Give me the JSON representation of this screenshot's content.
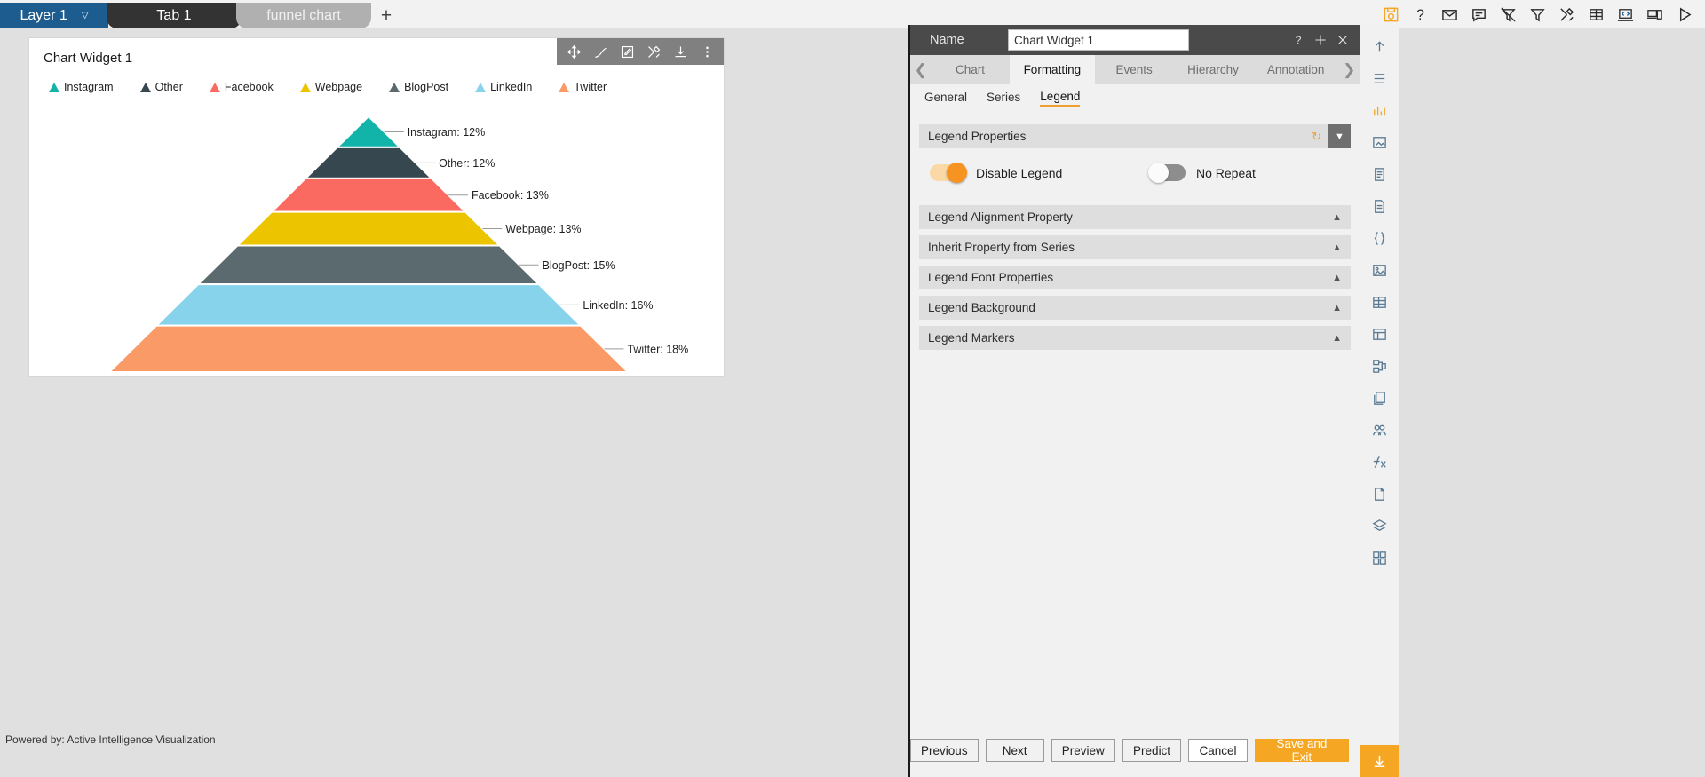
{
  "topbar": {
    "layer_tab": {
      "label": "Layer 1",
      "caret": "chevron-down-icon"
    },
    "tabs": [
      {
        "label": "Tab 1",
        "active": true
      },
      {
        "label": "funnel chart",
        "active": false
      }
    ],
    "add_tab_label": "+",
    "icons": [
      "save-icon",
      "help-icon",
      "mail-icon",
      "comment-icon",
      "filter-off-icon",
      "filter-icon",
      "tools-icon",
      "table-icon",
      "code-icon",
      "devices-icon",
      "play-icon"
    ]
  },
  "widget": {
    "title": "Chart Widget 1",
    "toolbar_icons": [
      "move-icon",
      "pen-icon",
      "edit-icon",
      "tools-icon",
      "download-icon",
      "more-icon"
    ]
  },
  "chart_data": {
    "type": "funnel",
    "title": "Chart Widget 1",
    "legend_position": "top",
    "categories": [
      "Instagram",
      "Other",
      "Facebook",
      "Webpage",
      "BlogPost",
      "LinkedIn",
      "Twitter"
    ],
    "values": [
      12,
      12,
      13,
      13,
      15,
      16,
      18
    ],
    "value_unit": "%",
    "colors": [
      "#12b3a8",
      "#37474f",
      "#fa6a61",
      "#edc400",
      "#5a6a6e",
      "#87d3ec",
      "#fa9b67"
    ],
    "labels": [
      "Instagram: 12%",
      "Other: 12%",
      "Facebook: 13%",
      "Webpage: 13%",
      "BlogPost: 15%",
      "LinkedIn: 16%",
      "Twitter: 18%"
    ],
    "legend": [
      {
        "label": "Instagram",
        "color": "#12b3a8"
      },
      {
        "label": "Other",
        "color": "#37474f"
      },
      {
        "label": "Facebook",
        "color": "#fa6a61"
      },
      {
        "label": "Webpage",
        "color": "#edc400"
      },
      {
        "label": "BlogPost",
        "color": "#5a6a6e"
      },
      {
        "label": "LinkedIn",
        "color": "#87d3ec"
      },
      {
        "label": "Twitter",
        "color": "#fa9b67"
      }
    ],
    "legend_marker": "triangle",
    "grid": false
  },
  "powered_by": "Powered by: Active Intelligence Visualization",
  "panel": {
    "name_label": "Name",
    "name_value": "Chart Widget 1",
    "name_placeholder": "Chart Widget 1",
    "header_icons": [
      "help-icon",
      "move-icon",
      "close-icon"
    ],
    "tabs": [
      {
        "label": "Chart",
        "active": false
      },
      {
        "label": "Formatting",
        "active": true
      },
      {
        "label": "Events",
        "active": false
      },
      {
        "label": "Hierarchy",
        "active": false
      },
      {
        "label": "Annotation",
        "active": false
      }
    ],
    "tab_prev_icon": "chevron-left-icon",
    "tab_next_icon": "chevron-right-icon",
    "subtabs": [
      {
        "label": "General",
        "active": false
      },
      {
        "label": "Series",
        "active": false
      },
      {
        "label": "Legend",
        "active": true
      }
    ],
    "sections": [
      {
        "title": "Legend Properties",
        "expanded": true,
        "has_refresh": true
      },
      {
        "title": "Legend Alignment Property",
        "expanded": false,
        "has_refresh": false
      },
      {
        "title": "Inherit Property from Series",
        "expanded": false,
        "has_refresh": false
      },
      {
        "title": "Legend Font Properties",
        "expanded": false,
        "has_refresh": false
      },
      {
        "title": "Legend Background",
        "expanded": false,
        "has_refresh": false
      },
      {
        "title": "Legend Markers",
        "expanded": false,
        "has_refresh": false
      }
    ],
    "toggles": [
      {
        "label": "Disable Legend",
        "state": "on"
      },
      {
        "label": "No Repeat",
        "state": "off"
      }
    ],
    "footer_buttons": [
      {
        "label": "Previous",
        "style": "default"
      },
      {
        "label": "Next",
        "style": "default"
      },
      {
        "label": "Preview",
        "style": "default"
      },
      {
        "label": "Predict",
        "style": "default"
      },
      {
        "label": "Cancel",
        "style": "white"
      },
      {
        "label": "Save and Exit",
        "style": "primary"
      }
    ]
  },
  "rail": {
    "icons": [
      "collapse-up-icon",
      "list-icon",
      "chart-bar-icon",
      "image-add-icon",
      "document-icon",
      "page-icon",
      "braces-icon",
      "picture-icon",
      "grid-icon",
      "layout-icon",
      "flow-icon",
      "copy-icon",
      "group-icon",
      "function-icon",
      "file-icon",
      "layers-icon",
      "widgets-icon"
    ],
    "bottom_icon": "download-icon"
  },
  "colors": {
    "accent": "#f5a623",
    "layer_tab": "#1d5c8f",
    "active_tab": "#333333",
    "panel_header": "#4a4a4a"
  }
}
